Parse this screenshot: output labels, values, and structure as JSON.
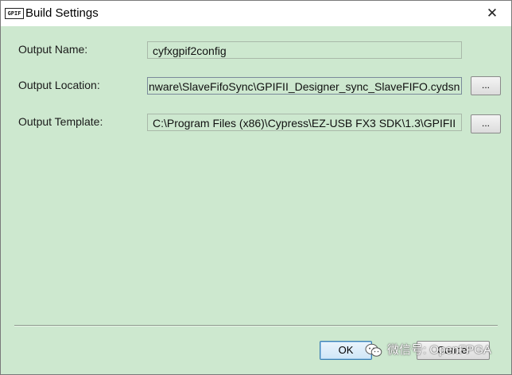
{
  "window": {
    "title": "Build Settings",
    "app_icon_text": "GPIF",
    "close_glyph": "✕"
  },
  "form": {
    "output_name": {
      "label": "Output Name:",
      "value": "cyfxgpif2config"
    },
    "output_location": {
      "label": "Output Location:",
      "value": "nware\\SlaveFifoSync\\GPIFII_Designer_sync_SlaveFIFO.cydsn",
      "browse_label": "..."
    },
    "output_template": {
      "label": "Output Template:",
      "value": "C:\\Program Files (x86)\\Cypress\\EZ-USB FX3 SDK\\1.3\\GPIFII",
      "browse_label": "..."
    }
  },
  "buttons": {
    "ok_label": "OK",
    "cancel_label": "Cancel"
  },
  "watermark": {
    "text": "微信号: OpenFPGA",
    "icon": "wechat-icon"
  },
  "colors": {
    "dialog_background": "#cde8cf",
    "titlebar_background": "#ffffff",
    "ok_button_border": "#3c7fb1"
  }
}
